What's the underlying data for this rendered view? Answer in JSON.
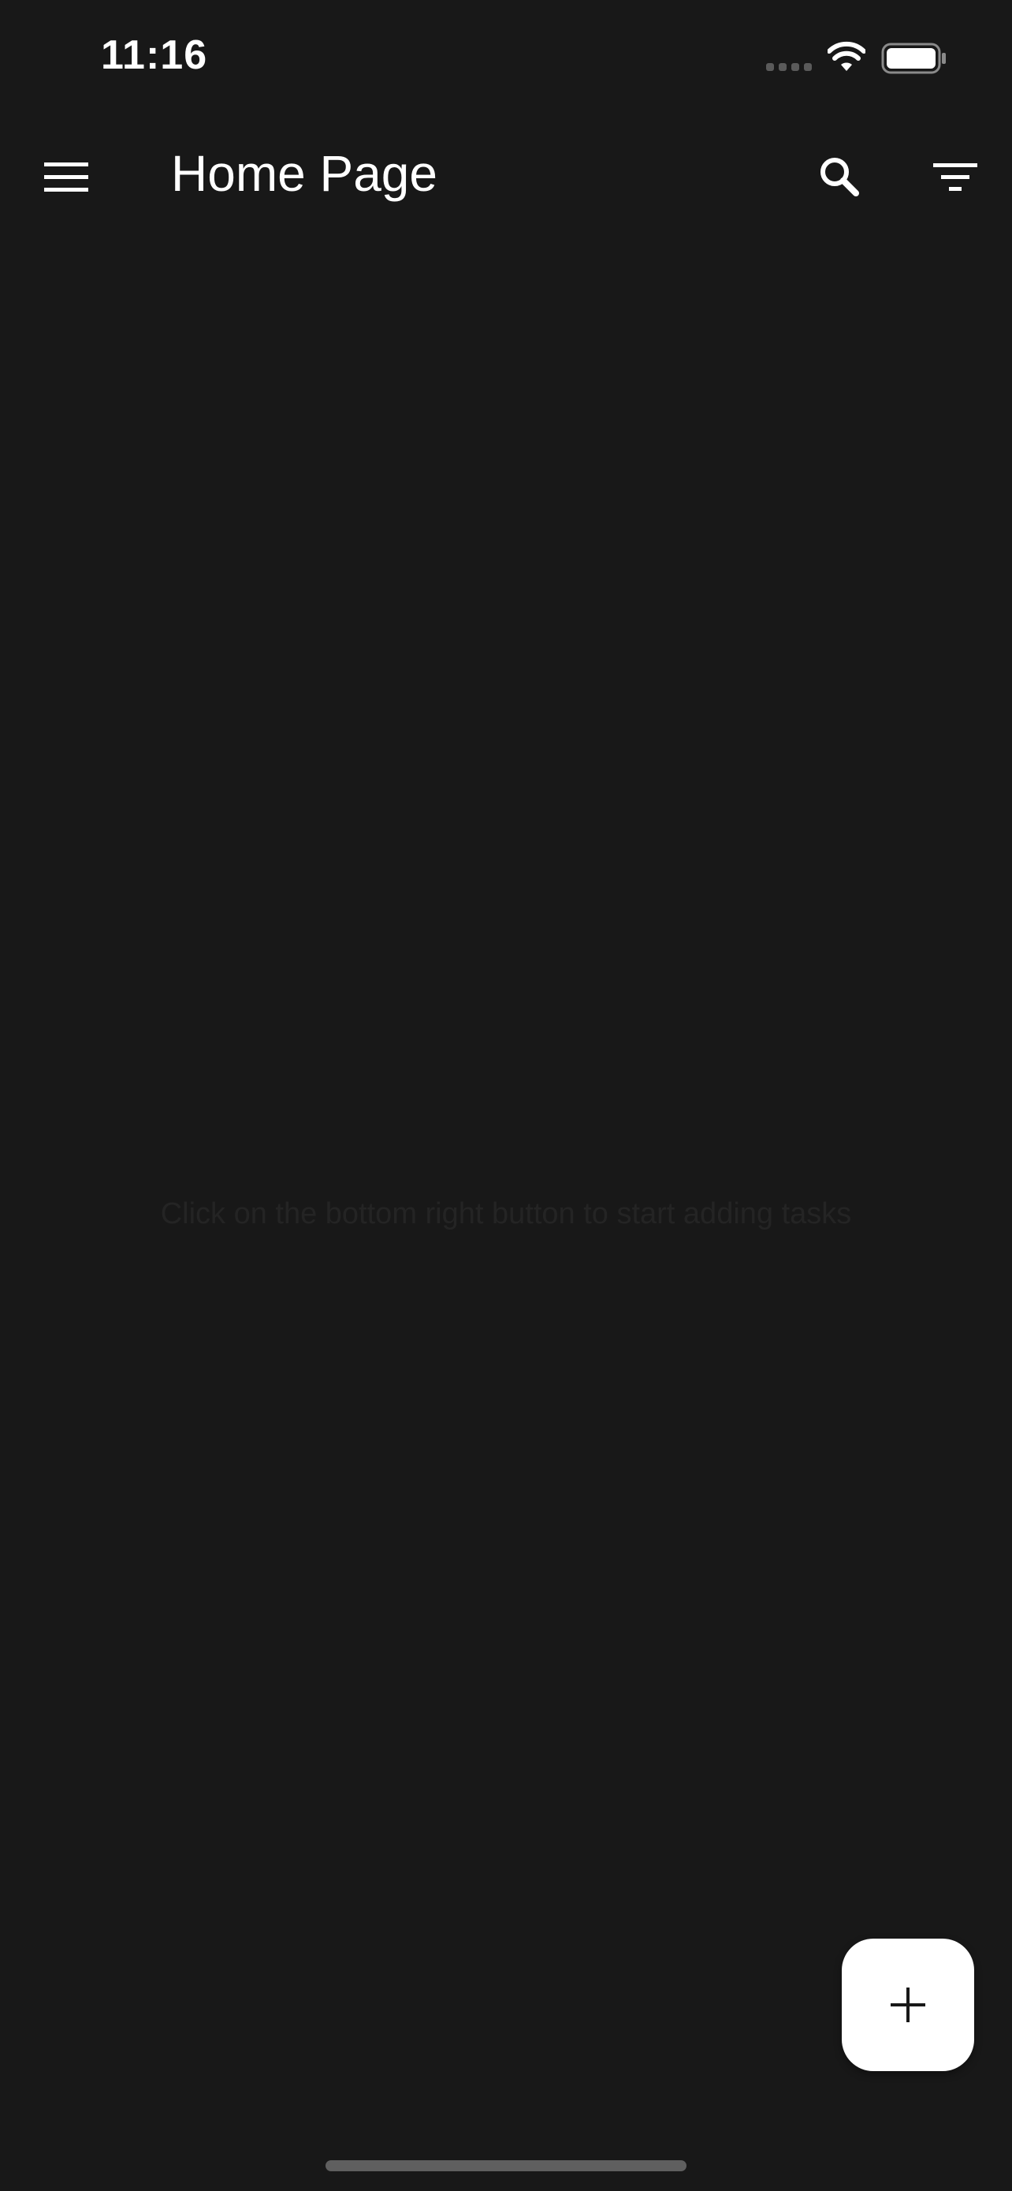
{
  "status_bar": {
    "time": "11:16",
    "icons": [
      "cellular-signal-icon",
      "wifi-icon",
      "battery-icon"
    ]
  },
  "app_bar": {
    "title": "Home Page",
    "icons": {
      "menu": "hamburger-menu-icon",
      "search": "search-icon",
      "filter": "filter-icon"
    }
  },
  "main": {
    "empty_message": "Click on the bottom right button to start adding tasks"
  },
  "fab": {
    "icon": "plus-icon"
  },
  "colors": {
    "background": "#181818",
    "foreground": "#ffffff",
    "empty_text": "#242424",
    "fab_background": "#ffffff",
    "fab_icon": "#181818",
    "home_indicator": "#5f5f5f"
  }
}
